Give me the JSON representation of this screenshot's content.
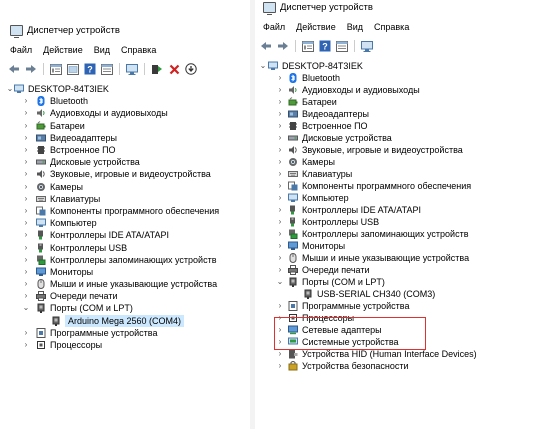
{
  "left": {
    "title": "Диспетчер устройств",
    "menu": [
      "Файл",
      "Действие",
      "Вид",
      "Справка"
    ],
    "root": "DESKTOP-84T3IEK",
    "items": [
      {
        "label": "Bluetooth",
        "icon": "bluetooth-icon"
      },
      {
        "label": "Аудиовходы и аудиовыходы",
        "icon": "speaker-icon"
      },
      {
        "label": "Батареи",
        "icon": "battery-icon"
      },
      {
        "label": "Видеоадаптеры",
        "icon": "display-adapter-icon"
      },
      {
        "label": "Встроенное ПО",
        "icon": "firmware-icon"
      },
      {
        "label": "Дисковые устройства",
        "icon": "disk-icon"
      },
      {
        "label": "Звуковые, игровые и видеоустройства",
        "icon": "sound-icon"
      },
      {
        "label": "Камеры",
        "icon": "camera-icon"
      },
      {
        "label": "Клавиатуры",
        "icon": "keyboard-icon"
      },
      {
        "label": "Компоненты программного обеспечения",
        "icon": "software-component-icon"
      },
      {
        "label": "Компьютер",
        "icon": "computer-icon"
      },
      {
        "label": "Контроллеры IDE ATA/ATAPI",
        "icon": "ide-controller-icon"
      },
      {
        "label": "Контроллеры USB",
        "icon": "usb-controller-icon"
      },
      {
        "label": "Контроллеры запоминающих устройств",
        "icon": "storage-controller-icon"
      },
      {
        "label": "Мониторы",
        "icon": "monitor-icon"
      },
      {
        "label": "Мыши и иные указывающие устройства",
        "icon": "mouse-icon"
      },
      {
        "label": "Очереди печати",
        "icon": "printer-icon"
      },
      {
        "label": "Порты (COM и LPT)",
        "icon": "port-icon",
        "expanded": true
      },
      {
        "label": "Arduino Mega 2560 (COM4)",
        "icon": "port-device-icon",
        "child": true,
        "selected": true
      },
      {
        "label": "Программные устройства",
        "icon": "software-device-icon"
      },
      {
        "label": "Процессоры",
        "icon": "processor-icon"
      }
    ]
  },
  "right": {
    "title": "Диспетчер устройств",
    "menu": [
      "Файл",
      "Действие",
      "Вид",
      "Справка"
    ],
    "root": "DESKTOP-84T3IEK",
    "items": [
      {
        "label": "Bluetooth",
        "icon": "bluetooth-icon"
      },
      {
        "label": "Аудиовходы и аудиовыходы",
        "icon": "speaker-icon"
      },
      {
        "label": "Батареи",
        "icon": "battery-icon"
      },
      {
        "label": "Видеоадаптеры",
        "icon": "display-adapter-icon"
      },
      {
        "label": "Встроенное ПО",
        "icon": "firmware-icon"
      },
      {
        "label": "Дисковые устройства",
        "icon": "disk-icon"
      },
      {
        "label": "Звуковые, игровые и видеоустройства",
        "icon": "sound-icon"
      },
      {
        "label": "Камеры",
        "icon": "camera-icon"
      },
      {
        "label": "Клавиатуры",
        "icon": "keyboard-icon"
      },
      {
        "label": "Компоненты программного обеспечения",
        "icon": "software-component-icon"
      },
      {
        "label": "Компьютер",
        "icon": "computer-icon"
      },
      {
        "label": "Контроллеры IDE ATA/ATAPI",
        "icon": "ide-controller-icon"
      },
      {
        "label": "Контроллеры USB",
        "icon": "usb-controller-icon"
      },
      {
        "label": "Контроллеры запоминающих устройств",
        "icon": "storage-controller-icon"
      },
      {
        "label": "Мониторы",
        "icon": "monitor-icon"
      },
      {
        "label": "Мыши и иные указывающие устройства",
        "icon": "mouse-icon"
      },
      {
        "label": "Очереди печати",
        "icon": "printer-icon"
      },
      {
        "label": "Порты (COM и LPT)",
        "icon": "port-icon",
        "expanded": true
      },
      {
        "label": "USB-SERIAL CH340 (COM3)",
        "icon": "port-device-icon",
        "child": true
      },
      {
        "label": "Программные устройства",
        "icon": "software-device-icon"
      },
      {
        "label": "Процессоры",
        "icon": "processor-icon"
      },
      {
        "label": "Сетевые адаптеры",
        "icon": "network-adapter-icon"
      },
      {
        "label": "Системные устройства",
        "icon": "system-device-icon"
      },
      {
        "label": "Устройства HID (Human Interface Devices)",
        "icon": "hid-icon"
      },
      {
        "label": "Устройства безопасности",
        "icon": "security-device-icon"
      }
    ]
  },
  "colors": {
    "selection": "#cce8ff",
    "highlight_box": "#e03030",
    "bluetooth": "#1a73e8"
  }
}
